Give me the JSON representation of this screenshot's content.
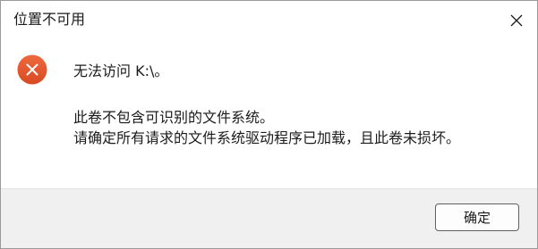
{
  "window": {
    "title": "位置不可用"
  },
  "message": {
    "main": "无法访问 K:\\。",
    "detail_line1": "此卷不包含可识别的文件系统。",
    "detail_line2": "请确定所有请求的文件系统驱动程序已加载，且此卷未损坏。"
  },
  "buttons": {
    "ok_label": "确定"
  },
  "icons": {
    "error": "error-icon",
    "close": "close-icon"
  },
  "colors": {
    "error_red": "#e4572e",
    "footer_bg": "#f0f0f0"
  }
}
